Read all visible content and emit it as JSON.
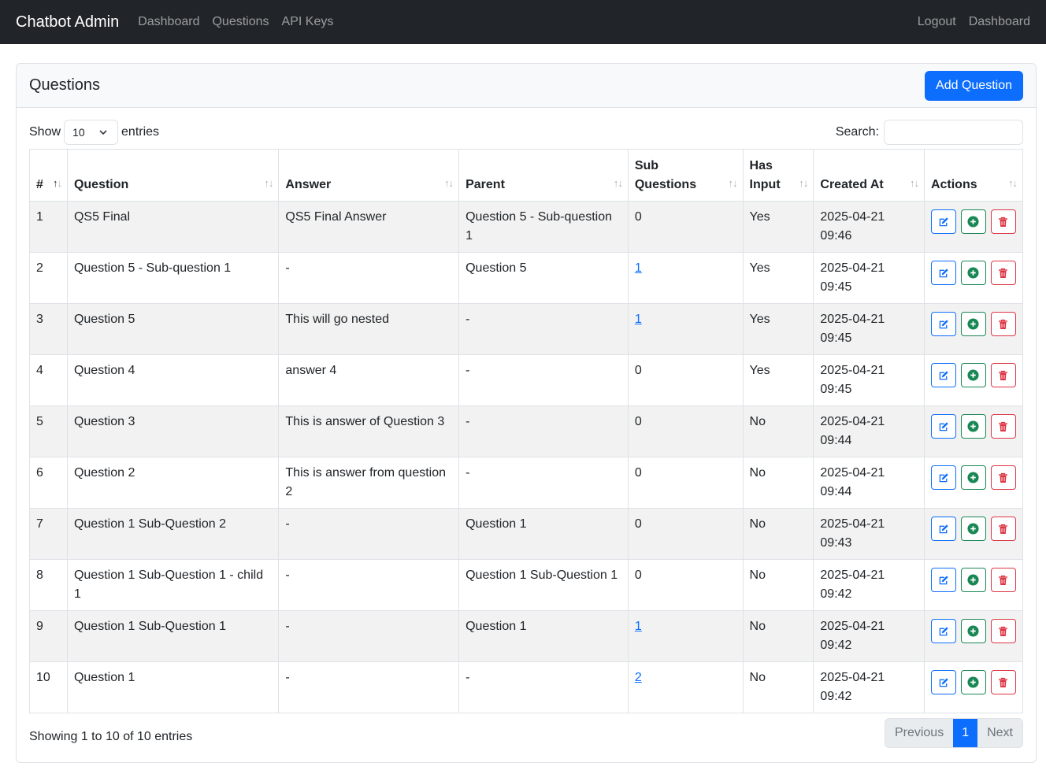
{
  "navbar": {
    "brand": "Chatbot Admin",
    "left_links": [
      "Dashboard",
      "Questions",
      "API Keys"
    ],
    "right_links": [
      "Logout",
      "Dashboard"
    ]
  },
  "card": {
    "title": "Questions",
    "add_button": "Add Question"
  },
  "length": {
    "prefix": "Show",
    "value": "10",
    "suffix": "entries"
  },
  "search": {
    "label": "Search:",
    "value": ""
  },
  "table": {
    "headers": [
      "#",
      "Question",
      "Answer",
      "Parent",
      "Sub Questions",
      "Has Input",
      "Created At",
      "Actions"
    ],
    "sorted_column": "#",
    "rows": [
      {
        "num": "1",
        "question": "QS5 Final",
        "answer": "QS5 Final Answer",
        "parent": "Question 5 - Sub-question 1",
        "sub": "0",
        "sub_link": false,
        "has_input": "Yes",
        "created": "2025-04-21 09:46"
      },
      {
        "num": "2",
        "question": "Question 5 - Sub-question 1",
        "answer": "-",
        "parent": "Question 5",
        "sub": "1",
        "sub_link": true,
        "has_input": "Yes",
        "created": "2025-04-21 09:45"
      },
      {
        "num": "3",
        "question": "Question 5",
        "answer": "This will go nested",
        "parent": "-",
        "sub": "1",
        "sub_link": true,
        "has_input": "Yes",
        "created": "2025-04-21 09:45"
      },
      {
        "num": "4",
        "question": "Question 4",
        "answer": "answer 4",
        "parent": "-",
        "sub": "0",
        "sub_link": false,
        "has_input": "Yes",
        "created": "2025-04-21 09:45"
      },
      {
        "num": "5",
        "question": "Question 3",
        "answer": "This is answer of Question 3",
        "parent": "-",
        "sub": "0",
        "sub_link": false,
        "has_input": "No",
        "created": "2025-04-21 09:44"
      },
      {
        "num": "6",
        "question": "Question 2",
        "answer": "This is answer from question 2",
        "parent": "-",
        "sub": "0",
        "sub_link": false,
        "has_input": "No",
        "created": "2025-04-21 09:44"
      },
      {
        "num": "7",
        "question": "Question 1 Sub-Question 2",
        "answer": "-",
        "parent": "Question 1",
        "sub": "0",
        "sub_link": false,
        "has_input": "No",
        "created": "2025-04-21 09:43"
      },
      {
        "num": "8",
        "question": "Question 1 Sub-Question 1 - child 1",
        "answer": "-",
        "parent": "Question 1 Sub-Question 1",
        "sub": "0",
        "sub_link": false,
        "has_input": "No",
        "created": "2025-04-21 09:42"
      },
      {
        "num": "9",
        "question": "Question 1 Sub-Question 1",
        "answer": "-",
        "parent": "Question 1",
        "sub": "1",
        "sub_link": true,
        "has_input": "No",
        "created": "2025-04-21 09:42"
      },
      {
        "num": "10",
        "question": "Question 1",
        "answer": "-",
        "parent": "-",
        "sub": "2",
        "sub_link": true,
        "has_input": "No",
        "created": "2025-04-21 09:42"
      }
    ]
  },
  "info": "Showing 1 to 10 of 10 entries",
  "pagination": {
    "previous": "Previous",
    "current": "1",
    "next": "Next"
  },
  "colors": {
    "navbar_bg": "#212529",
    "primary": "#0d6efd",
    "success": "#198754",
    "danger": "#dc3545",
    "stripe": "#f2f2f2"
  },
  "icons": {
    "edit": "pencil-square-icon",
    "add": "plus-circle-icon",
    "delete": "trash-icon",
    "sort": "sort-arrows-icon",
    "select": "chevron-down-icon"
  }
}
